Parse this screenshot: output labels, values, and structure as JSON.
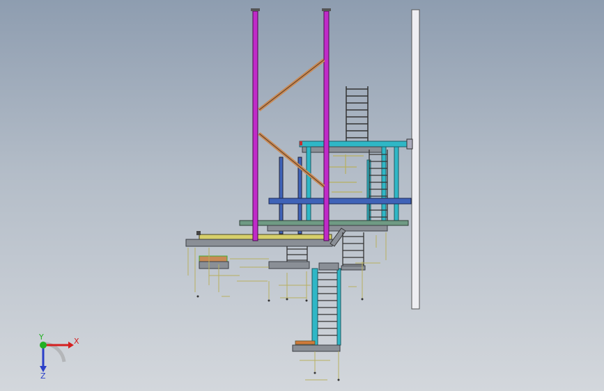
{
  "viewport": {
    "background_top": "#8e9db0",
    "background_bottom": "#d3d7dc"
  },
  "colors": {
    "column": "#c02ac8",
    "brace": "#c98a56",
    "beam_blue": "#3f63b8",
    "beam_cyan": "#2fb7c6",
    "beam_green": "#6f9a84",
    "deck_yellow": "#d6cf6a",
    "steel_gray": "#8a8f96",
    "dark_line": "#3a3e44",
    "dim_line": "#b8b060",
    "wall_white": "#eeeef2",
    "orange_part": "#d07a3a"
  },
  "triad": {
    "x_label": "X",
    "y_label": "Y",
    "z_label": "Z",
    "x_color": "#d42020",
    "y_color": "#22b022",
    "z_color": "#2a3fc8"
  }
}
